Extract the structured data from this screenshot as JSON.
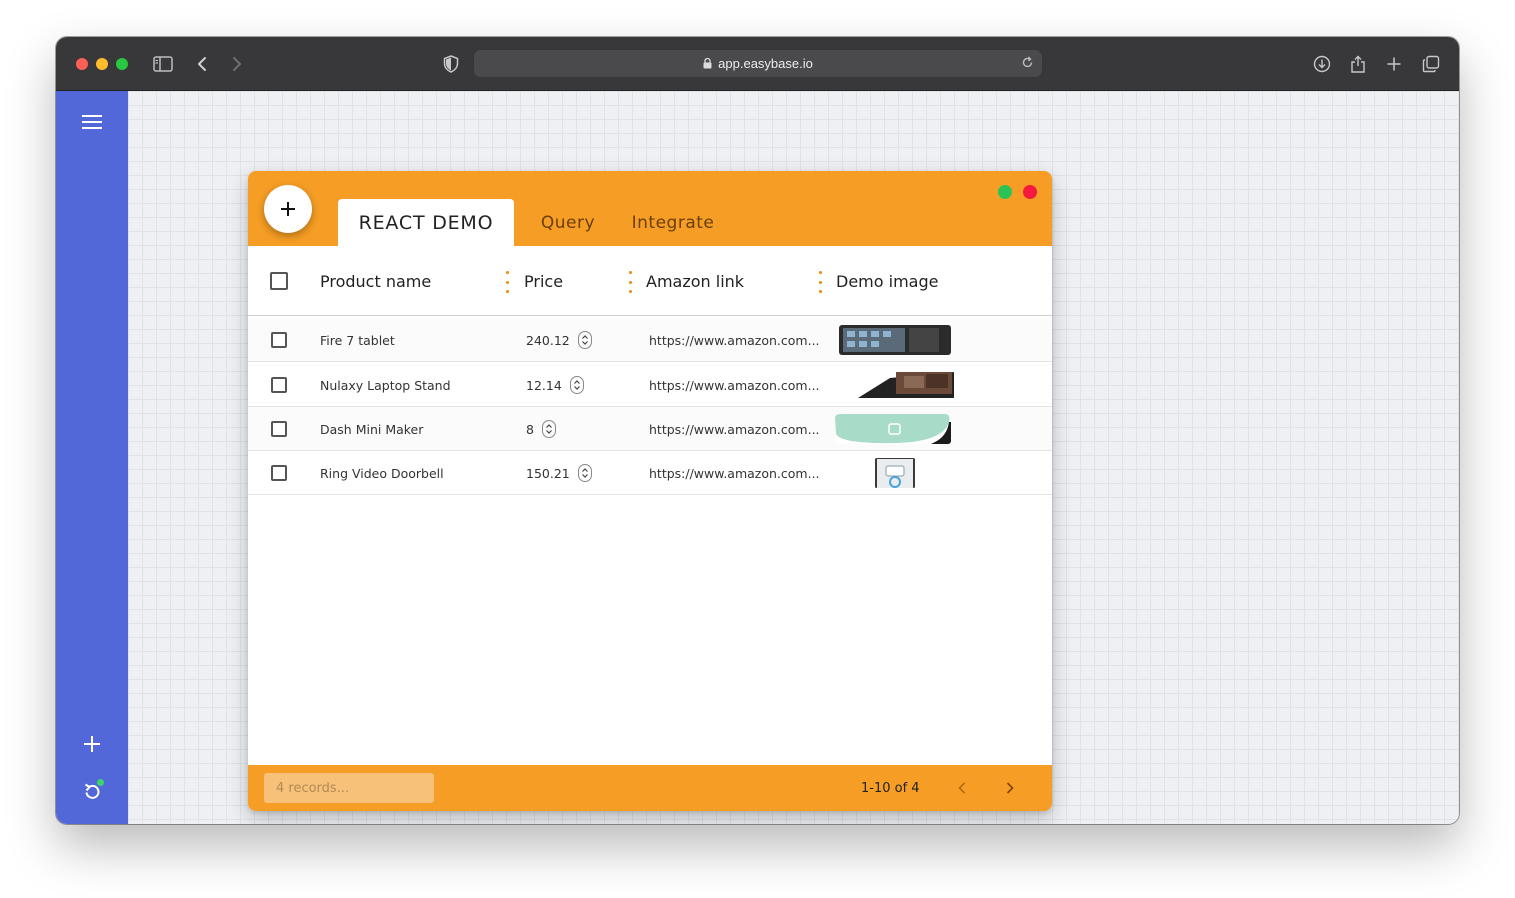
{
  "browser": {
    "url": "app.easybase.io"
  },
  "card": {
    "tabs": [
      {
        "label": "REACT DEMO",
        "active": true
      },
      {
        "label": "Query",
        "active": false
      },
      {
        "label": "Integrate",
        "active": false
      }
    ]
  },
  "table": {
    "columns": [
      "Product name",
      "Price",
      "Amazon link",
      "Demo image"
    ],
    "rows": [
      {
        "name": "Fire 7 tablet",
        "price": "240.12",
        "link": "https://www.amazon.com..."
      },
      {
        "name": "Nulaxy Laptop Stand",
        "price": "12.14",
        "link": "https://www.amazon.com..."
      },
      {
        "name": "Dash Mini Maker",
        "price": "8",
        "link": "https://www.amazon.com..."
      },
      {
        "name": "Ring Video Doorbell",
        "price": "150.21",
        "link": "https://www.amazon.com..."
      }
    ]
  },
  "footer": {
    "search_placeholder": "4 records...",
    "pagination": "1-10 of 4"
  },
  "colors": {
    "accent": "#f59d24",
    "sidebar": "#5268d8",
    "dot_green": "#2bc355",
    "dot_red": "#f51a3c"
  }
}
